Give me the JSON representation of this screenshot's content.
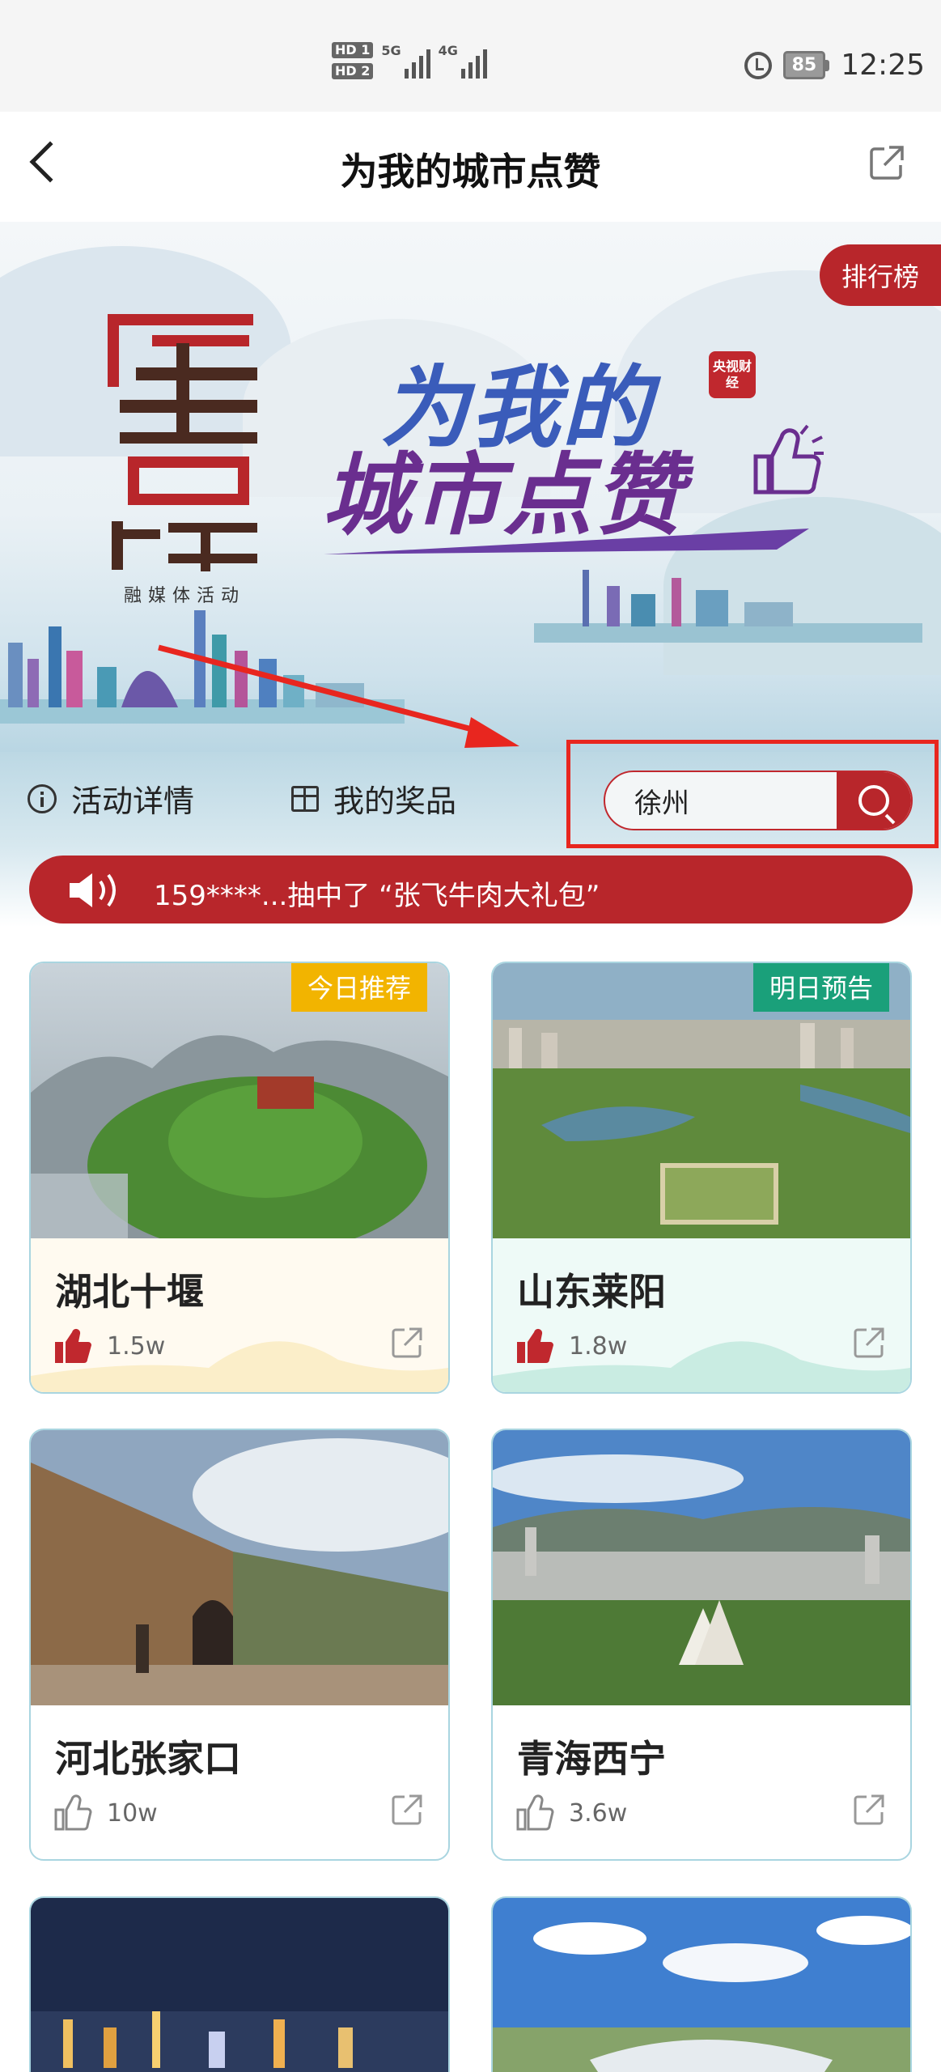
{
  "status_bar": {
    "hd1": "HD 1",
    "hd2": "HD 2",
    "net1": "5G",
    "net2": "4G",
    "battery": "85",
    "time": "12:25"
  },
  "nav": {
    "title": "为我的城市点赞"
  },
  "banner": {
    "rank_label": "排行榜",
    "logo_subtitle": "融媒体活动",
    "cctv_badge": "央视财经",
    "headline_line1": "为我的",
    "headline_line2": "城市点赞"
  },
  "actions": {
    "details_label": "活动详情",
    "prizes_label": "我的奖品"
  },
  "search": {
    "value": "徐州",
    "placeholder": ""
  },
  "ticker": {
    "text": "159****...抽中了 “张飞牛肉大礼包”"
  },
  "cards": [
    {
      "name": "湖北十堰",
      "likes": "1.5w",
      "badge": "今日推荐",
      "liked": true
    },
    {
      "name": "山东莱阳",
      "likes": "1.8w",
      "badge": "明日预告",
      "liked": true
    },
    {
      "name": "河北张家口",
      "likes": "10w",
      "badge": "",
      "liked": false
    },
    {
      "name": "青海西宁",
      "likes": "3.6w",
      "badge": "",
      "liked": false
    }
  ],
  "colors": {
    "brand_red": "#b8262b",
    "badge_yellow": "#f2b400",
    "badge_green": "#1aa07a",
    "card_border": "#a9d5e0"
  }
}
